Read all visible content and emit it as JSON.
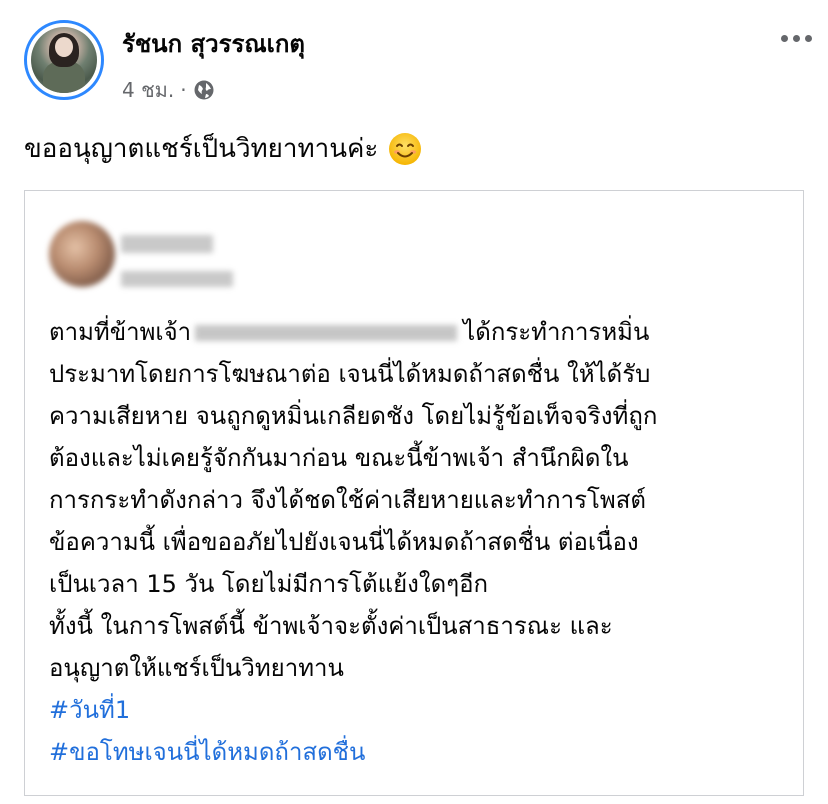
{
  "author": {
    "name": "รัชนก สุวรรณเกตุ",
    "time": "4 ชม.",
    "separator": "·"
  },
  "icons": {
    "globe": "globe-icon",
    "more": "more-options-icon",
    "emoji": "smiling-face-emoji"
  },
  "post": {
    "text": "ขออนุญาตแชร์เป็นวิทยาทานค่ะ"
  },
  "shared": {
    "line1_prefix": "ตามที่ข้าพเจ้า",
    "line1_suffix": "ได้กระทำการหมิ่น",
    "lines": [
      "ประมาทโดยการโฆษณาต่อ เจนนี่ได้หมดถ้าสดชื่น ให้ได้รับ",
      "ความเสียหาย จนถูกดูหมิ่นเกลียดชัง โดยไม่รู้ข้อเท็จจริงที่ถูก",
      "ต้องและไม่เคยรู้จักกันมาก่อน ขณะนี้ข้าพเจ้า สำนึกผิดใน",
      "การกระทำดังกล่าว จึงได้ชดใช้ค่าเสียหายและทำการโพสต์",
      "ข้อความนี้ เพื่อขออภัยไปยังเจนนี่ได้หมดถ้าสดชื่น ต่อเนื่อง",
      "เป็นเวลา 15 วัน โดยไม่มีการโต้แย้งใดๆอีก",
      "ทั้งนี้ ในการโพสต์นี้ ข้าพเจ้าจะตั้งค่าเป็นสาธารณะ และ",
      "อนุญาตให้แชร์เป็นวิทยาทาน"
    ],
    "hashtags": [
      "#วันที่1",
      "#ขอโทษเจนนี่ได้หมดถ้าสดชื่น"
    ]
  },
  "colors": {
    "hashtag": "#216fdb",
    "secondary": "#65676b",
    "avatar_ring": "#2d88ff",
    "card_border": "#ced0d4"
  }
}
